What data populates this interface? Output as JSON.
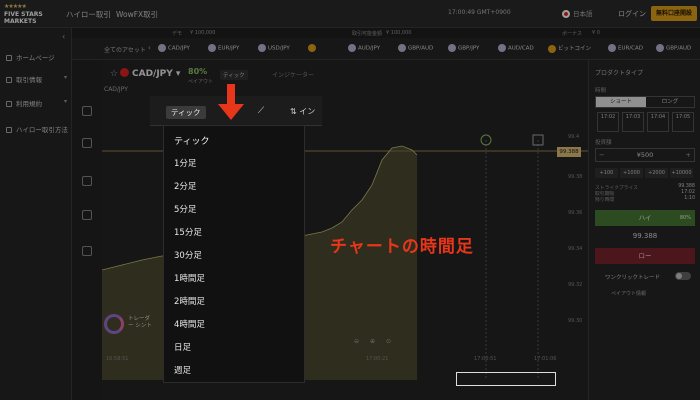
{
  "header": {
    "brand_line1": "FIVE STARS",
    "brand_line2": "MARKETS",
    "stars": "★★★★★",
    "nav_binary": "ハイロー取引",
    "nav_wowfx": "WowFX取引",
    "clock": "17:00:49  GMT+0900",
    "language": "日本語",
    "login": "ログイン",
    "open_account": "無料口座開設"
  },
  "ticker": {
    "all_assets": "全てのアセット",
    "pairs": [
      {
        "label": "CAD/JPY",
        "icon": "currency-pair-icon"
      },
      {
        "label": "EUR/JPY",
        "icon": "currency-pair-icon"
      },
      {
        "label": "USD/JPY",
        "icon": "currency-pair-icon"
      },
      {
        "label": "AUD/JPY",
        "icon": "currency-pair-icon"
      },
      {
        "label": "GBP/AUD",
        "icon": "currency-pair-icon"
      },
      {
        "label": "GBP/JPY",
        "icon": "currency-pair-icon"
      },
      {
        "label": "AUD/CAD",
        "icon": "currency-pair-icon"
      },
      {
        "label": "ビットコイン",
        "icon": "bitcoin-icon"
      },
      {
        "label": "EUR/CAD",
        "icon": "currency-pair-icon"
      },
      {
        "label": "GBP/AUD",
        "icon": "currency-pair-icon"
      }
    ],
    "top_line": [
      {
        "label": "デモ",
        "value": "¥ 100,000"
      },
      {
        "label": "取引可能金額",
        "value": "¥ 100,000"
      },
      {
        "label": "ボーナス",
        "value": "¥ 0"
      }
    ]
  },
  "sidebar": {
    "items": [
      {
        "label": "ホームページ"
      },
      {
        "label": "取引情報"
      },
      {
        "label": "利用規約"
      },
      {
        "label": "ハイロー取引方法"
      }
    ]
  },
  "chart": {
    "pair": "CAD/JPY",
    "payout_pct": "80%",
    "payout_label": "ペイアウト",
    "tick_btn": "ティック",
    "indicators": "インジケーター",
    "chart_pair_label": "CAD/JPY",
    "current_price": "99.388",
    "yticks": [
      "99.4",
      "99.38",
      "99.36",
      "99.34",
      "99.32",
      "99.30"
    ],
    "xticks": [
      "16:58:51",
      "16:59:06",
      "16:59:21",
      "16:59:36",
      "16:59:51",
      "17:00:06",
      "17:00:21",
      "17:00:36",
      "17:00:51",
      "17:01:06"
    ],
    "trader_label": "トレーダー\nシント"
  },
  "timeframe_menu": {
    "tick_button": "ティック",
    "indicator_short": "イン",
    "items": [
      "ティック",
      "1分足",
      "2分足",
      "5分足",
      "15分足",
      "30分足",
      "1時間足",
      "2時間足",
      "4時間足",
      "日足",
      "週足"
    ]
  },
  "annotation": {
    "caption": "チャートの時間足"
  },
  "right_panel": {
    "title": "プロダクトタイプ",
    "time_label": "時間",
    "short": "ショート",
    "long": "ロング",
    "expiries": [
      "17:02",
      "17:03",
      "17:04",
      "17:05"
    ],
    "amount_label": "投資額",
    "amount": "¥500",
    "quick_amounts": [
      "+100",
      "+1000",
      "+2000",
      "+10000"
    ],
    "strike_label": "ストライクプライス",
    "strike_value": "99.388",
    "expiry_label": "取引期限",
    "expiry_value": "17:02",
    "remaining_label": "残り時間",
    "remaining_value": "1:10",
    "high": "ハイ",
    "high_pct": "80%",
    "current": "99.388",
    "low": "ロー",
    "one_click": "ワンクリックトレード",
    "payout_info": "ペイアウト情報"
  },
  "colors": {
    "accent_orange": "#e3a21a",
    "annotation_red": "#e8361a",
    "high_green": "#4a7a36",
    "low_red": "#7a2630"
  }
}
